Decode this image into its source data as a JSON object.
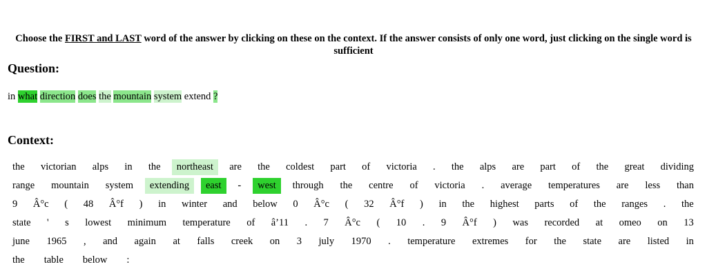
{
  "instruction": {
    "prefix": "Choose the ",
    "emphasis": "FIRST and LAST",
    "rest": " word of the answer by clicking on these on the context. If the answer consists of only one word, just clicking on the single word is sufficient"
  },
  "question_heading": "Question:",
  "question_tokens": [
    {
      "text": "in",
      "hl": ""
    },
    {
      "text": "what",
      "hl": "strong"
    },
    {
      "text": "direction",
      "hl": "medium"
    },
    {
      "text": "does",
      "hl": "medium"
    },
    {
      "text": "the",
      "hl": "light"
    },
    {
      "text": "mountain",
      "hl": "medium"
    },
    {
      "text": "system",
      "hl": "light"
    },
    {
      "text": "extend",
      "hl": ""
    },
    {
      "text": "?",
      "hl": "medium"
    }
  ],
  "context_heading": "Context:",
  "context_rows": [
    [
      {
        "text": "the",
        "hl": ""
      },
      {
        "text": "victorian",
        "hl": ""
      },
      {
        "text": "alps",
        "hl": ""
      },
      {
        "text": "in",
        "hl": ""
      },
      {
        "text": "the",
        "hl": ""
      },
      {
        "text": "northeast",
        "hl": "light"
      },
      {
        "text": "are",
        "hl": ""
      },
      {
        "text": "the",
        "hl": ""
      },
      {
        "text": "coldest",
        "hl": ""
      },
      {
        "text": "part",
        "hl": ""
      },
      {
        "text": "of",
        "hl": ""
      },
      {
        "text": "victoria",
        "hl": ""
      },
      {
        "text": ".",
        "hl": ""
      },
      {
        "text": "the",
        "hl": ""
      },
      {
        "text": "alps",
        "hl": ""
      },
      {
        "text": "are",
        "hl": ""
      },
      {
        "text": "part",
        "hl": ""
      },
      {
        "text": "of",
        "hl": ""
      },
      {
        "text": "the",
        "hl": ""
      },
      {
        "text": "great",
        "hl": ""
      },
      {
        "text": "dividing",
        "hl": ""
      }
    ],
    [
      {
        "text": "range",
        "hl": ""
      },
      {
        "text": "mountain",
        "hl": ""
      },
      {
        "text": "system",
        "hl": ""
      },
      {
        "text": "extending",
        "hl": "light"
      },
      {
        "text": "east",
        "hl": "strong"
      },
      {
        "text": "-",
        "hl": ""
      },
      {
        "text": "west",
        "hl": "strong"
      },
      {
        "text": "through",
        "hl": ""
      },
      {
        "text": "the",
        "hl": ""
      },
      {
        "text": "centre",
        "hl": ""
      },
      {
        "text": "of",
        "hl": ""
      },
      {
        "text": "victoria",
        "hl": ""
      },
      {
        "text": ".",
        "hl": ""
      },
      {
        "text": "average",
        "hl": ""
      },
      {
        "text": "temperatures",
        "hl": ""
      },
      {
        "text": "are",
        "hl": ""
      },
      {
        "text": "less",
        "hl": ""
      },
      {
        "text": "than",
        "hl": ""
      }
    ],
    [
      {
        "text": "9",
        "hl": ""
      },
      {
        "text": "Â°c",
        "hl": ""
      },
      {
        "text": "(",
        "hl": ""
      },
      {
        "text": "48",
        "hl": ""
      },
      {
        "text": "Â°f",
        "hl": ""
      },
      {
        "text": ")",
        "hl": ""
      },
      {
        "text": "in",
        "hl": ""
      },
      {
        "text": "winter",
        "hl": ""
      },
      {
        "text": "and",
        "hl": ""
      },
      {
        "text": "below",
        "hl": ""
      },
      {
        "text": "0",
        "hl": ""
      },
      {
        "text": "Â°c",
        "hl": ""
      },
      {
        "text": "(",
        "hl": ""
      },
      {
        "text": "32",
        "hl": ""
      },
      {
        "text": "Â°f",
        "hl": ""
      },
      {
        "text": ")",
        "hl": ""
      },
      {
        "text": "in",
        "hl": ""
      },
      {
        "text": "the",
        "hl": ""
      },
      {
        "text": "highest",
        "hl": ""
      },
      {
        "text": "parts",
        "hl": ""
      },
      {
        "text": "of",
        "hl": ""
      },
      {
        "text": "the",
        "hl": ""
      },
      {
        "text": "ranges",
        "hl": ""
      },
      {
        "text": ".",
        "hl": ""
      },
      {
        "text": "the",
        "hl": ""
      }
    ],
    [
      {
        "text": "state",
        "hl": ""
      },
      {
        "text": "'",
        "hl": ""
      },
      {
        "text": "s",
        "hl": ""
      },
      {
        "text": "lowest",
        "hl": ""
      },
      {
        "text": "minimum",
        "hl": ""
      },
      {
        "text": "temperature",
        "hl": ""
      },
      {
        "text": "of",
        "hl": ""
      },
      {
        "text": "â’11",
        "hl": ""
      },
      {
        "text": ".",
        "hl": ""
      },
      {
        "text": "7",
        "hl": ""
      },
      {
        "text": "Â°c",
        "hl": ""
      },
      {
        "text": "(",
        "hl": ""
      },
      {
        "text": "10",
        "hl": ""
      },
      {
        "text": ".",
        "hl": ""
      },
      {
        "text": "9",
        "hl": ""
      },
      {
        "text": "Â°f",
        "hl": ""
      },
      {
        "text": ")",
        "hl": ""
      },
      {
        "text": "was",
        "hl": ""
      },
      {
        "text": "recorded",
        "hl": ""
      },
      {
        "text": "at",
        "hl": ""
      },
      {
        "text": "omeo",
        "hl": ""
      },
      {
        "text": "on",
        "hl": ""
      },
      {
        "text": "13",
        "hl": ""
      }
    ],
    [
      {
        "text": "june",
        "hl": ""
      },
      {
        "text": "1965",
        "hl": ""
      },
      {
        "text": ",",
        "hl": ""
      },
      {
        "text": "and",
        "hl": ""
      },
      {
        "text": "again",
        "hl": ""
      },
      {
        "text": "at",
        "hl": ""
      },
      {
        "text": "falls",
        "hl": ""
      },
      {
        "text": "creek",
        "hl": ""
      },
      {
        "text": "on",
        "hl": ""
      },
      {
        "text": "3",
        "hl": ""
      },
      {
        "text": "july",
        "hl": ""
      },
      {
        "text": "1970",
        "hl": ""
      },
      {
        "text": ".",
        "hl": ""
      },
      {
        "text": "temperature",
        "hl": ""
      },
      {
        "text": "extremes",
        "hl": ""
      },
      {
        "text": "for",
        "hl": ""
      },
      {
        "text": "the",
        "hl": ""
      },
      {
        "text": "state",
        "hl": ""
      },
      {
        "text": "are",
        "hl": ""
      },
      {
        "text": "listed",
        "hl": ""
      },
      {
        "text": "in",
        "hl": ""
      }
    ],
    [
      {
        "text": "the",
        "hl": ""
      },
      {
        "text": "table",
        "hl": ""
      },
      {
        "text": "below",
        "hl": ""
      },
      {
        "text": ":",
        "hl": ""
      }
    ]
  ],
  "highlight_colors": {
    "strong": "#2ed12e",
    "medium": "#8be68b",
    "light": "#cdf3cd"
  }
}
